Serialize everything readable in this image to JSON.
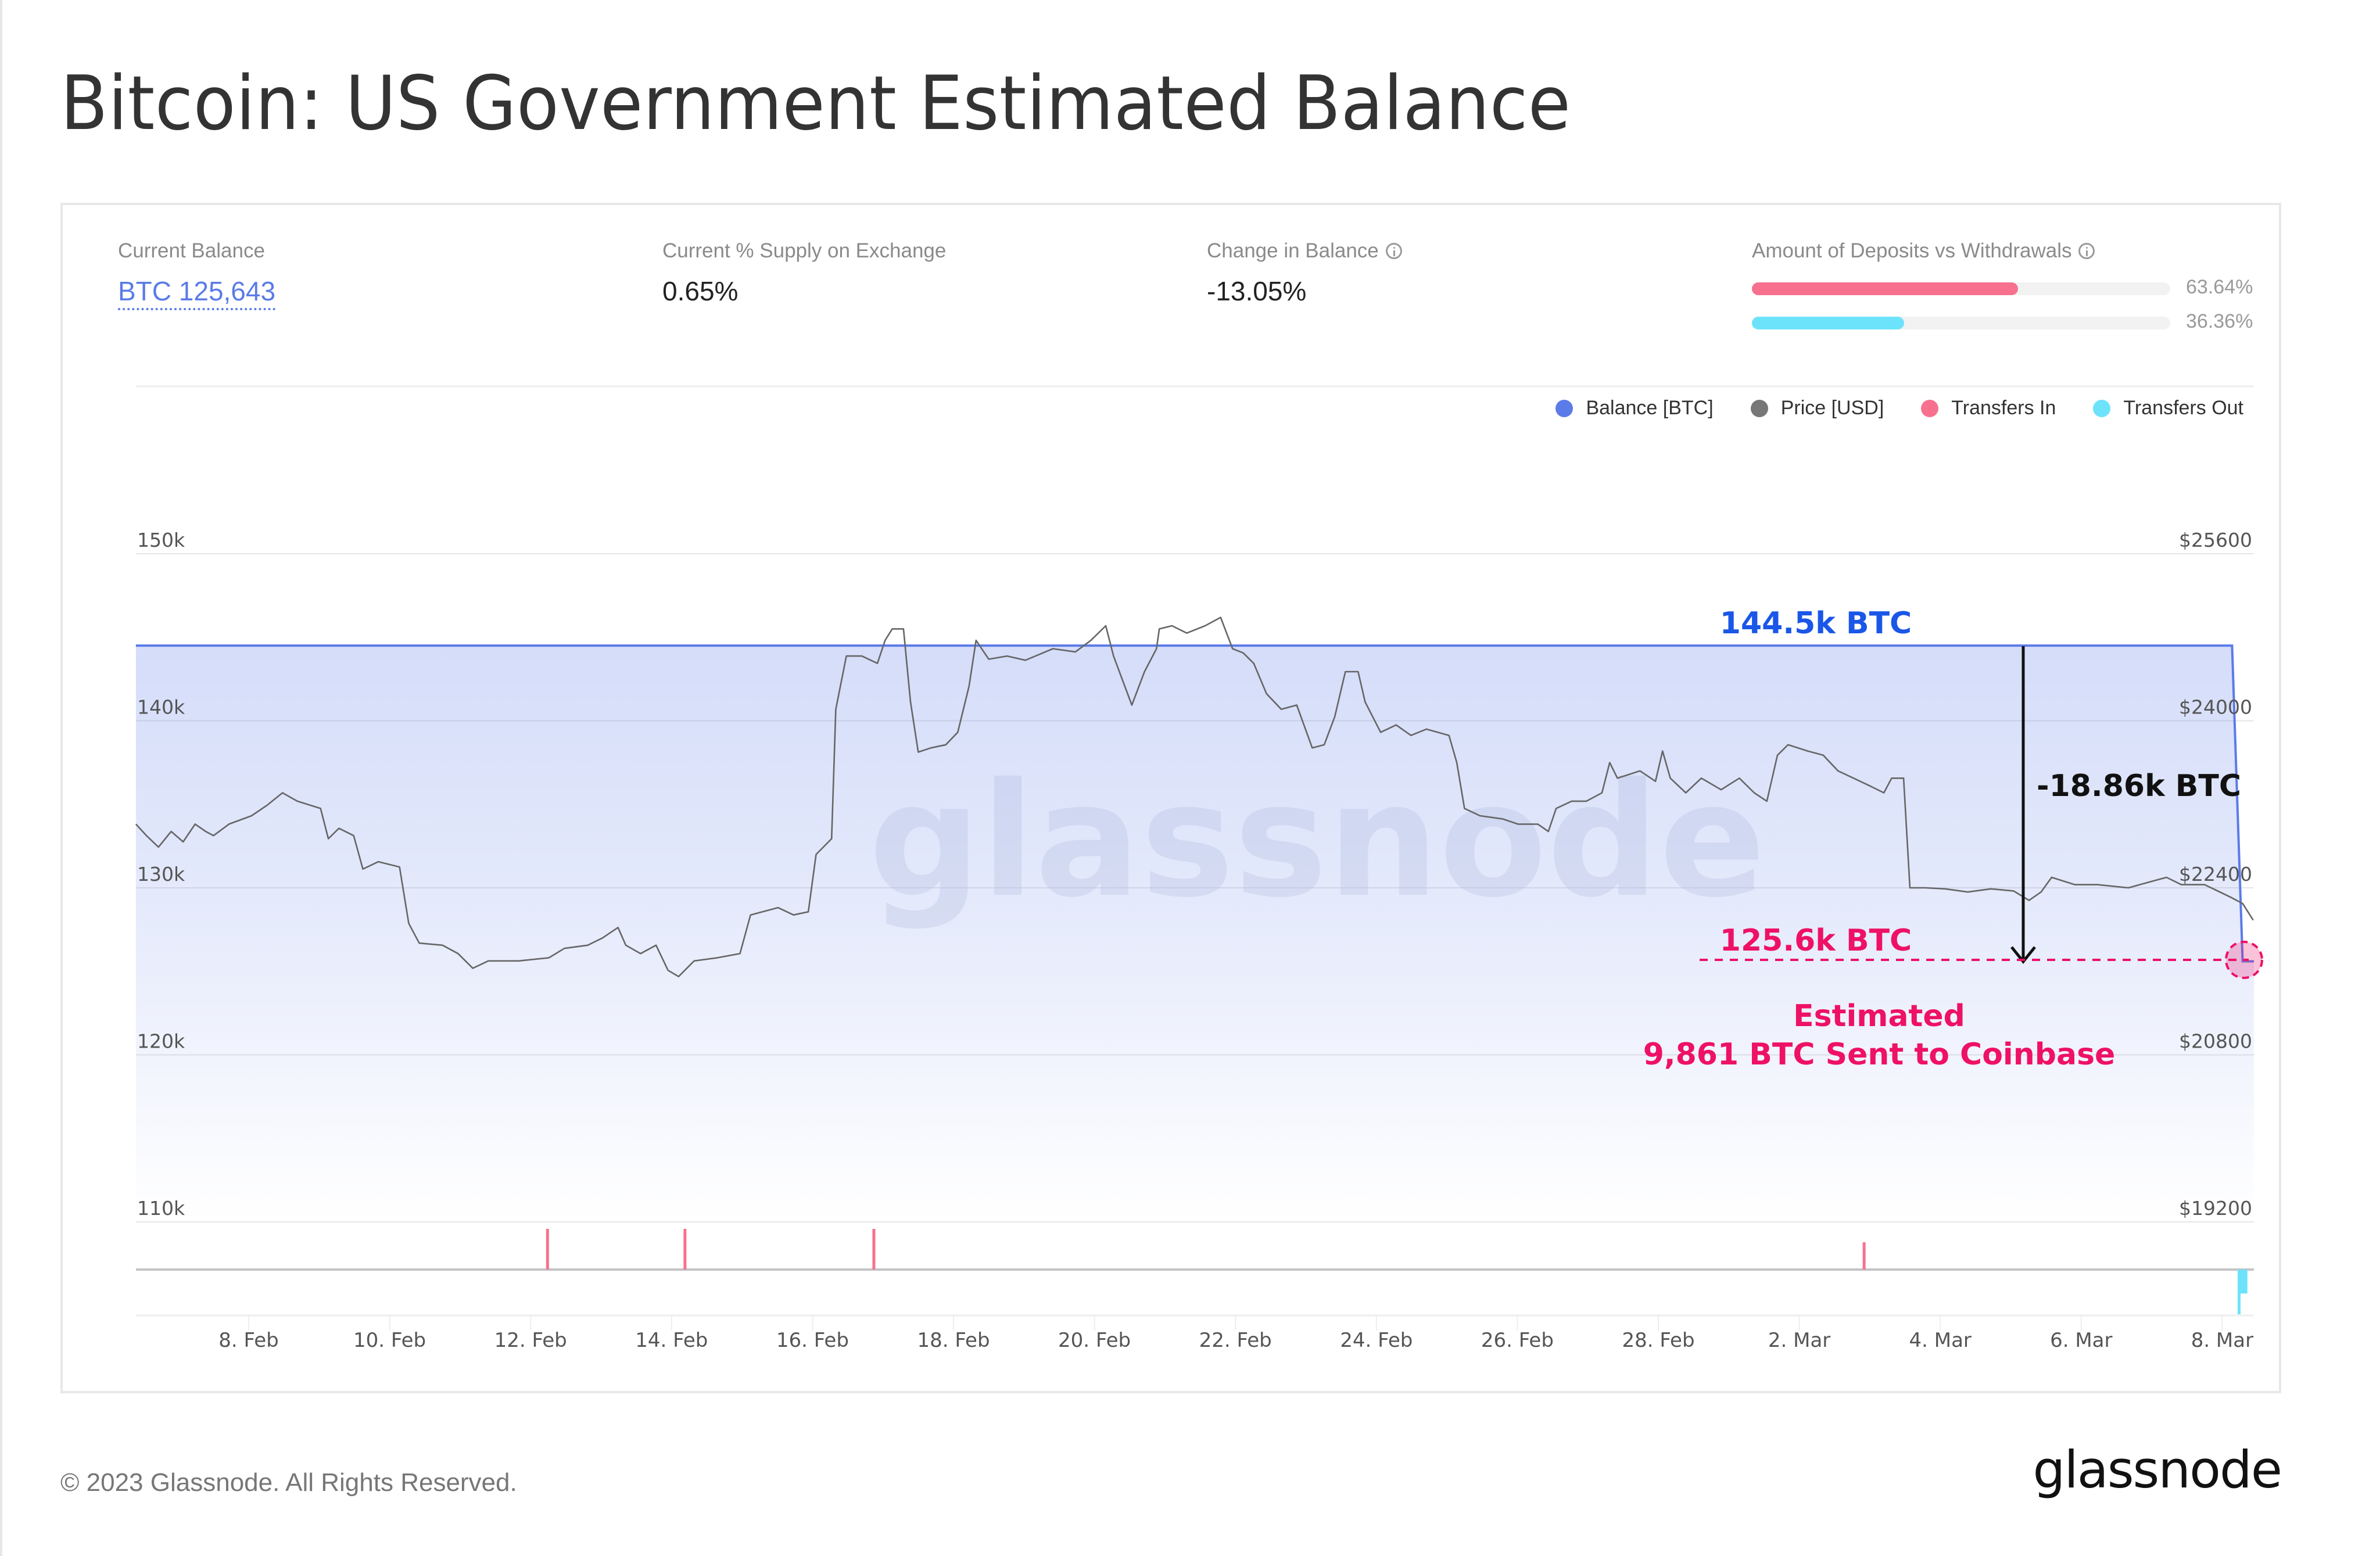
{
  "page": {
    "title": "Bitcoin: US Government Estimated Balance"
  },
  "stats": [
    {
      "label": "Current Balance",
      "value": "BTC 125,643",
      "info": false,
      "link": true
    },
    {
      "label": "Current % Supply on Exchange",
      "value": "0.65%",
      "info": false,
      "link": false
    },
    {
      "label": "Change in Balance",
      "value": "-13.05%",
      "info": true,
      "link": false
    }
  ],
  "deposits_vs_withdrawals": {
    "label": "Amount of Deposits vs Withdrawals",
    "deposits_pct": 63.64,
    "withdrawals_pct": 36.36,
    "deposits_label": "63.64%",
    "withdrawals_label": "36.36%",
    "deposits_color": "#f7718f",
    "withdrawals_color": "#6de3fb"
  },
  "legend": [
    {
      "label": "Balance [BTC]",
      "color": "#5b7be8",
      "icon": "circle-icon"
    },
    {
      "label": "Price [USD]",
      "color": "#777777",
      "icon": "circle-icon"
    },
    {
      "label": "Transfers In",
      "color": "#f7718f",
      "icon": "circle-icon"
    },
    {
      "label": "Transfers Out",
      "color": "#6de3fb",
      "icon": "circle-icon"
    }
  ],
  "watermark": "glassnode",
  "annotations": {
    "top_balance": "144.5k BTC",
    "change": "-18.86k BTC",
    "bottom_balance": "125.6k BTC",
    "note_line1": "Estimated",
    "note_line2": "9,861 BTC Sent to Coinbase",
    "top_color": "#1a56e8",
    "change_color": "#111111",
    "bottom_color": "#ee1166"
  },
  "footer": {
    "copyright": "© 2023 Glassnode. All Rights Reserved.",
    "logo": "glassnode"
  },
  "chart_data": {
    "type": "line",
    "title": "Bitcoin: US Government Estimated Balance",
    "x_unit": "days since 8 Feb 2023",
    "x_range": [
      -1.6,
      28.45
    ],
    "x_ticks": [
      {
        "d": 0,
        "label": "8. Feb"
      },
      {
        "d": 2,
        "label": "10. Feb"
      },
      {
        "d": 4,
        "label": "12. Feb"
      },
      {
        "d": 6,
        "label": "14. Feb"
      },
      {
        "d": 8,
        "label": "16. Feb"
      },
      {
        "d": 10,
        "label": "18. Feb"
      },
      {
        "d": 12,
        "label": "20. Feb"
      },
      {
        "d": 14,
        "label": "22. Feb"
      },
      {
        "d": 16,
        "label": "24. Feb"
      },
      {
        "d": 18,
        "label": "26. Feb"
      },
      {
        "d": 20,
        "label": "28. Feb"
      },
      {
        "d": 22,
        "label": "2. Mar"
      },
      {
        "d": 24,
        "label": "4. Mar"
      },
      {
        "d": 26,
        "label": "6. Mar"
      },
      {
        "d": 28,
        "label": "8. Mar"
      }
    ],
    "y_left": {
      "label": "Balance [BTC]",
      "range": [
        110000,
        150000
      ],
      "ticks": [
        {
          "v": 150000,
          "label": "150k"
        },
        {
          "v": 140000,
          "label": "140k"
        },
        {
          "v": 130000,
          "label": "130k"
        },
        {
          "v": 120000,
          "label": "120k"
        },
        {
          "v": 110000,
          "label": "110k"
        }
      ]
    },
    "y_right": {
      "label": "Price [USD]",
      "range": [
        19200,
        25600
      ],
      "ticks": [
        {
          "v": 25600,
          "label": "$25600"
        },
        {
          "v": 24000,
          "label": "$24000"
        },
        {
          "v": 22400,
          "label": "$22400"
        },
        {
          "v": 20800,
          "label": "$20800"
        },
        {
          "v": 19200,
          "label": "$19200"
        }
      ]
    },
    "grid": true,
    "legend_position": "top-right",
    "series": [
      {
        "name": "Balance [BTC]",
        "axis": "left",
        "color": "#5b7be8",
        "points": [
          [
            -1.6,
            144500
          ],
          [
            28.14,
            144500
          ],
          [
            28.29,
            125600
          ],
          [
            28.45,
            125600
          ]
        ]
      },
      {
        "name": "Price [USD]",
        "axis": "right",
        "color": "#666666",
        "points": [
          [
            -1.6,
            23010
          ],
          [
            -1.45,
            22900
          ],
          [
            -1.28,
            22790
          ],
          [
            -1.1,
            22940
          ],
          [
            -0.93,
            22840
          ],
          [
            -0.76,
            23010
          ],
          [
            -0.61,
            22940
          ],
          [
            -0.5,
            22900
          ],
          [
            -0.28,
            23010
          ],
          [
            0.04,
            23090
          ],
          [
            0.26,
            23190
          ],
          [
            0.48,
            23310
          ],
          [
            0.69,
            23230
          ],
          [
            1.02,
            23160
          ],
          [
            1.13,
            22870
          ],
          [
            1.28,
            22970
          ],
          [
            1.49,
            22900
          ],
          [
            1.62,
            22580
          ],
          [
            1.84,
            22650
          ],
          [
            2.14,
            22600
          ],
          [
            2.27,
            22060
          ],
          [
            2.42,
            21870
          ],
          [
            2.75,
            21850
          ],
          [
            2.97,
            21770
          ],
          [
            3.18,
            21630
          ],
          [
            3.4,
            21700
          ],
          [
            3.83,
            21700
          ],
          [
            4.26,
            21730
          ],
          [
            4.48,
            21820
          ],
          [
            4.81,
            21850
          ],
          [
            5.02,
            21920
          ],
          [
            5.24,
            22020
          ],
          [
            5.35,
            21850
          ],
          [
            5.56,
            21770
          ],
          [
            5.78,
            21850
          ],
          [
            5.95,
            21610
          ],
          [
            6.1,
            21550
          ],
          [
            6.32,
            21700
          ],
          [
            6.65,
            21730
          ],
          [
            6.97,
            21770
          ],
          [
            7.12,
            22140
          ],
          [
            7.29,
            22170
          ],
          [
            7.51,
            22210
          ],
          [
            7.73,
            22140
          ],
          [
            7.94,
            22170
          ],
          [
            8.05,
            22720
          ],
          [
            8.27,
            22870
          ],
          [
            8.33,
            24110
          ],
          [
            8.48,
            24620
          ],
          [
            8.7,
            24620
          ],
          [
            8.92,
            24550
          ],
          [
            9.03,
            24770
          ],
          [
            9.13,
            24880
          ],
          [
            9.29,
            24880
          ],
          [
            9.39,
            24180
          ],
          [
            9.5,
            23700
          ],
          [
            9.68,
            23740
          ],
          [
            9.89,
            23770
          ],
          [
            10.06,
            23890
          ],
          [
            10.22,
            24330
          ],
          [
            10.32,
            24770
          ],
          [
            10.5,
            24590
          ],
          [
            10.76,
            24620
          ],
          [
            11.02,
            24580
          ],
          [
            11.41,
            24690
          ],
          [
            11.73,
            24660
          ],
          [
            11.95,
            24770
          ],
          [
            12.16,
            24910
          ],
          [
            12.27,
            24620
          ],
          [
            12.53,
            24150
          ],
          [
            12.71,
            24470
          ],
          [
            12.88,
            24690
          ],
          [
            12.92,
            24880
          ],
          [
            13.1,
            24910
          ],
          [
            13.31,
            24840
          ],
          [
            13.57,
            24910
          ],
          [
            13.79,
            24990
          ],
          [
            13.96,
            24690
          ],
          [
            14.11,
            24650
          ],
          [
            14.26,
            24550
          ],
          [
            14.44,
            24260
          ],
          [
            14.65,
            24110
          ],
          [
            14.87,
            24150
          ],
          [
            15.09,
            23740
          ],
          [
            15.26,
            23770
          ],
          [
            15.41,
            24040
          ],
          [
            15.56,
            24470
          ],
          [
            15.74,
            24470
          ],
          [
            15.84,
            24180
          ],
          [
            16.06,
            23890
          ],
          [
            16.28,
            23960
          ],
          [
            16.49,
            23860
          ],
          [
            16.71,
            23920
          ],
          [
            17.03,
            23860
          ],
          [
            17.14,
            23600
          ],
          [
            17.25,
            23160
          ],
          [
            17.47,
            23090
          ],
          [
            17.79,
            23060
          ],
          [
            18.01,
            23010
          ],
          [
            18.29,
            23010
          ],
          [
            18.44,
            22940
          ],
          [
            18.55,
            23160
          ],
          [
            18.77,
            23230
          ],
          [
            18.98,
            23230
          ],
          [
            19.2,
            23310
          ],
          [
            19.31,
            23600
          ],
          [
            19.42,
            23450
          ],
          [
            19.74,
            23520
          ],
          [
            19.96,
            23420
          ],
          [
            20.06,
            23710
          ],
          [
            20.17,
            23450
          ],
          [
            20.39,
            23310
          ],
          [
            20.61,
            23450
          ],
          [
            20.89,
            23340
          ],
          [
            21.15,
            23450
          ],
          [
            21.36,
            23310
          ],
          [
            21.54,
            23230
          ],
          [
            21.69,
            23670
          ],
          [
            21.84,
            23770
          ],
          [
            22.12,
            23710
          ],
          [
            22.34,
            23670
          ],
          [
            22.55,
            23520
          ],
          [
            22.77,
            23450
          ],
          [
            22.99,
            23380
          ],
          [
            23.2,
            23310
          ],
          [
            23.31,
            23450
          ],
          [
            23.48,
            23450
          ],
          [
            23.57,
            22400
          ],
          [
            23.79,
            22400
          ],
          [
            24.07,
            22390
          ],
          [
            24.39,
            22360
          ],
          [
            24.72,
            22390
          ],
          [
            25.04,
            22370
          ],
          [
            25.26,
            22280
          ],
          [
            25.43,
            22360
          ],
          [
            25.58,
            22500
          ],
          [
            25.91,
            22430
          ],
          [
            26.23,
            22430
          ],
          [
            26.67,
            22400
          ],
          [
            26.99,
            22460
          ],
          [
            27.21,
            22500
          ],
          [
            27.42,
            22430
          ],
          [
            27.75,
            22430
          ],
          [
            28.12,
            22310
          ],
          [
            28.29,
            22250
          ],
          [
            28.44,
            22090
          ]
        ]
      },
      {
        "name": "Transfers In",
        "color": "#f7718f",
        "relative_values": [
          [
            4.24,
            1.0
          ],
          [
            6.19,
            1.0
          ],
          [
            8.87,
            1.0
          ],
          [
            22.92,
            0.67
          ]
        ]
      },
      {
        "name": "Transfers Out",
        "color": "#6de3fb",
        "relative_values": [
          [
            28.24,
            -1.4
          ],
          [
            28.3,
            -0.75
          ]
        ]
      }
    ]
  }
}
